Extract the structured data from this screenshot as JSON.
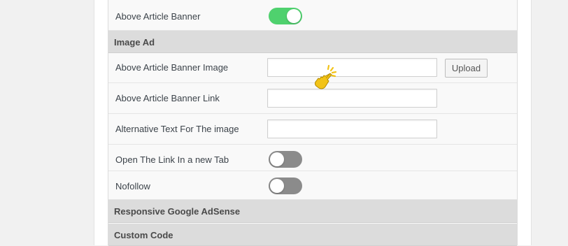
{
  "settings": {
    "above_article_banner": {
      "label": "Above Article Banner",
      "enabled": true
    },
    "image_ad_section": {
      "title": "Image Ad"
    },
    "banner_image": {
      "label": "Above Article Banner Image",
      "value": "",
      "upload_label": "Upload"
    },
    "banner_link": {
      "label": "Above Article Banner Link",
      "value": ""
    },
    "alt_text": {
      "label": "Alternative Text For The image",
      "value": ""
    },
    "new_tab": {
      "label": "Open The Link In a new Tab",
      "enabled": false
    },
    "nofollow": {
      "label": "Nofollow",
      "enabled": false
    },
    "adsense_section": {
      "title": "Responsive Google AdSense"
    },
    "custom_code_section": {
      "title": "Custom Code"
    }
  },
  "colors": {
    "toggle_on": "#4fd16e",
    "toggle_off": "#8b8b8b",
    "section_bg": "#dcdcdc",
    "cursor": "#f2c318"
  },
  "icons": {
    "pointer": "hand-pointer-click-icon"
  }
}
